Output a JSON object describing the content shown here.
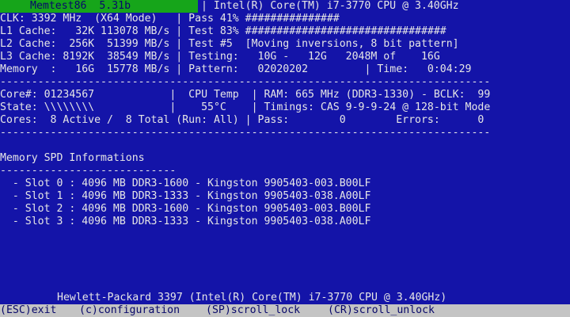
{
  "header": {
    "title": "Memtest86  5.31b",
    "cpu_line": "| Intel(R) Core(TM) i7-3770 CPU @ 3.40GHz"
  },
  "lines": [
    "CLK: 3392 MHz  (X64 Mode)   | Pass 41% ###############",
    "L1 Cache:   32K 113078 MB/s | Test 83% ################################",
    "L2 Cache:  256K  51399 MB/s | Test #5  [Moving inversions, 8 bit pattern]",
    "L3 Cache: 8192K  38549 MB/s | Testing:   10G -   12G   2048M of    16G",
    "Memory  :   16G  15778 MB/s | Pattern:   02020202         | Time:   0:04:29",
    "------------------------------------------------------------------------------",
    "Core#: 01234567            |  CPU Temp  | RAM: 665 MHz (DDR3-1330) - BCLK:  99",
    "State: \\\\\\\\\\\\\\\\            |    55°C    | Timings: CAS 9-9-9-24 @ 128-bit Mode",
    "Cores:  8 Active /  8 Total (Run: All) | Pass:        0        Errors:      0",
    "------------------------------------------------------------------------------"
  ],
  "spd": {
    "heading": "Memory SPD Informations",
    "underline": "----------------------------",
    "slots": [
      "  - Slot 0 : 4096 MB DDR3-1600 - Kingston 9905403-003.B00LF",
      "  - Slot 1 : 4096 MB DDR3-1333 - Kingston 9905403-038.A00LF",
      "  - Slot 2 : 4096 MB DDR3-1600 - Kingston 9905403-003.B00LF",
      "  - Slot 3 : 4096 MB DDR3-1333 - Kingston 9905403-038.A00LF"
    ]
  },
  "system_line": "Hewlett-Packard 3397 (Intel(R) Core(TM) i7-3770 CPU @ 3.40GHz)",
  "footer": {
    "esc": "(ESC)exit",
    "config": "(c)configuration",
    "scroll_lock": "(SP)scroll_lock",
    "scroll_unlock": "(CR)scroll_unlock"
  },
  "colors": {
    "background": "#1414a8",
    "title_bar": "#16a51a",
    "footer_bar": "#c4c4c4"
  }
}
